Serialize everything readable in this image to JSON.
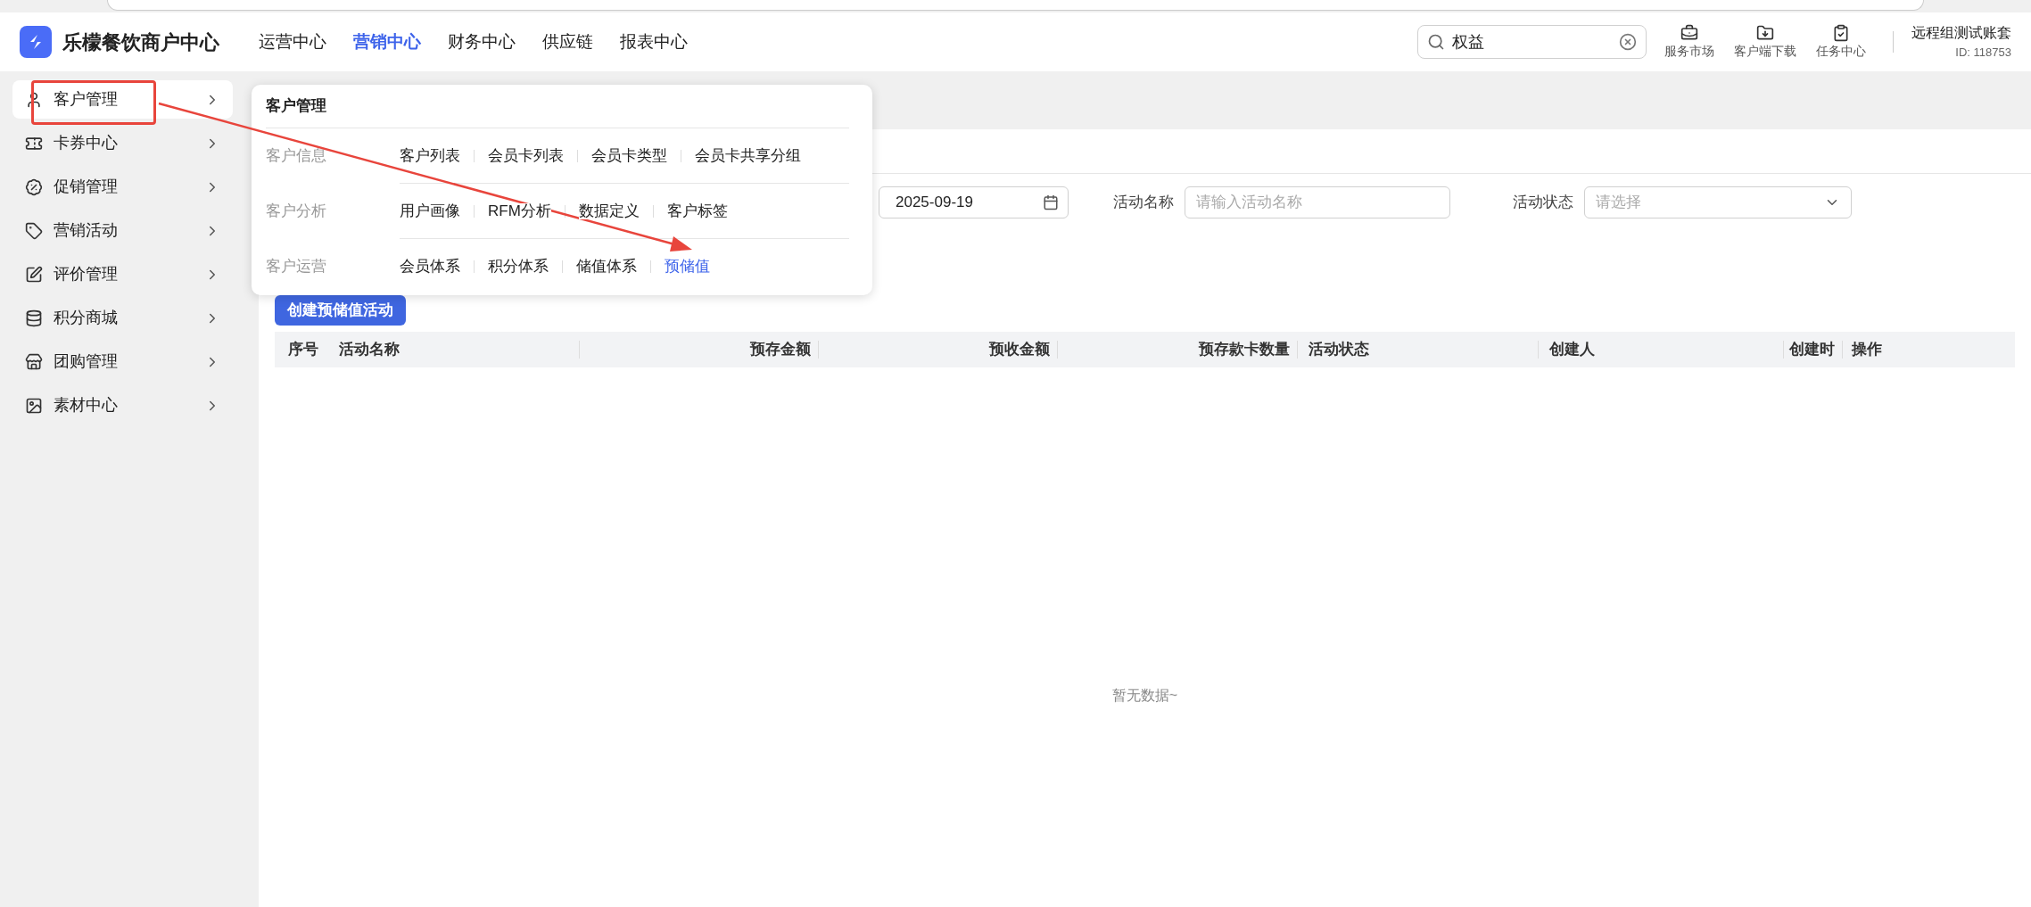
{
  "header": {
    "brand": "乐檬餐饮商户中心",
    "nav": [
      {
        "label": "运营中心",
        "selected": false
      },
      {
        "label": "营销中心",
        "selected": true
      },
      {
        "label": "财务中心",
        "selected": false
      },
      {
        "label": "供应链",
        "selected": false
      },
      {
        "label": "报表中心",
        "selected": false
      }
    ],
    "search": {
      "value": "权益"
    },
    "tools": [
      "服务市场",
      "客户端下载",
      "任务中心"
    ],
    "account": {
      "name": "远程组测试账套",
      "id": "ID: 118753"
    }
  },
  "sidebar": {
    "items": [
      {
        "label": "客户管理",
        "selected": true
      },
      {
        "label": "卡券中心",
        "selected": false
      },
      {
        "label": "促销管理",
        "selected": false
      },
      {
        "label": "营销活动",
        "selected": false
      },
      {
        "label": "评价管理",
        "selected": false
      },
      {
        "label": "积分商城",
        "selected": false
      },
      {
        "label": "团购管理",
        "selected": false
      },
      {
        "label": "素材中心",
        "selected": false
      }
    ]
  },
  "menu": {
    "title": "客户管理",
    "groups": [
      {
        "label": "客户信息",
        "links": [
          {
            "label": "客户列表",
            "selected": false
          },
          {
            "label": "会员卡列表",
            "selected": false
          },
          {
            "label": "会员卡类型",
            "selected": false
          },
          {
            "label": "会员卡共享分组",
            "selected": false
          }
        ]
      },
      {
        "label": "客户分析",
        "links": [
          {
            "label": "用户画像",
            "selected": false
          },
          {
            "label": "RFM分析",
            "selected": false
          },
          {
            "label": "数据定义",
            "selected": false
          },
          {
            "label": "客户标签",
            "selected": false
          }
        ]
      },
      {
        "label": "客户运营",
        "links": [
          {
            "label": "会员体系",
            "selected": false
          },
          {
            "label": "积分体系",
            "selected": false
          },
          {
            "label": "储值体系",
            "selected": false
          },
          {
            "label": "预储值",
            "selected": true
          }
        ]
      }
    ]
  },
  "filters": {
    "date_end": "2025-09-19",
    "name_label": "活动名称",
    "name_placeholder": "请输入活动名称",
    "status_label": "活动状态",
    "status_placeholder": "请选择"
  },
  "create_button": "创建预储值活动",
  "table": {
    "columns": [
      "序号",
      "活动名称",
      "预存金额",
      "预收金额",
      "预存款卡数量",
      "活动状态",
      "创建人",
      "创建时",
      "操作"
    ],
    "empty_text": "暂无数据~"
  }
}
